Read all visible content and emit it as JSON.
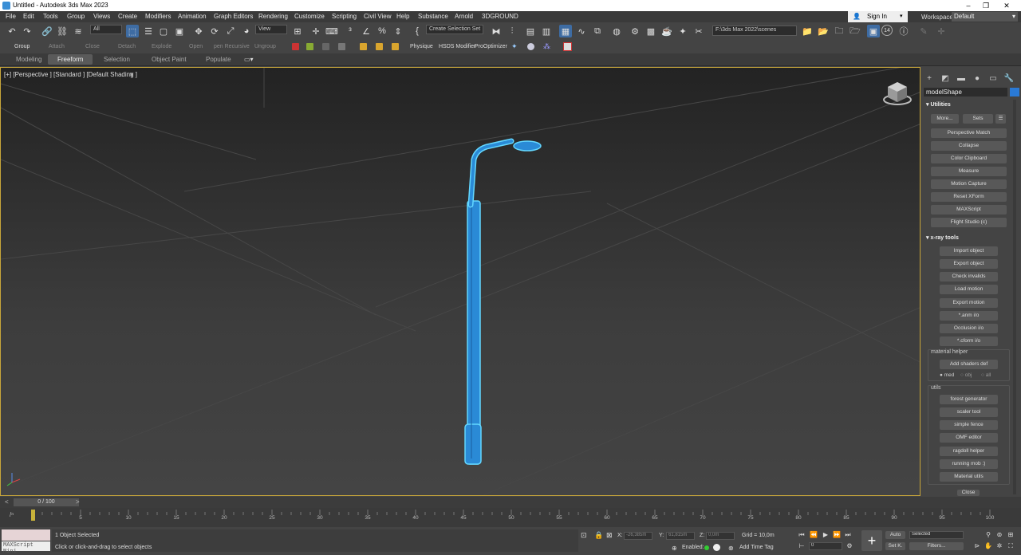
{
  "window": {
    "title": "Untitled - Autodesk 3ds Max 2023"
  },
  "menu": {
    "items": [
      "File",
      "Edit",
      "Tools",
      "Group",
      "Views",
      "Create",
      "Modifiers",
      "Animation",
      "Graph Editors",
      "Rendering",
      "Customize",
      "Scripting",
      "Civil View",
      "Help",
      "Substance",
      "Arnold",
      "3DGROUND"
    ],
    "sign_in": "Sign In",
    "workspaces_label": "Workspaces:",
    "workspaces_value": "Default"
  },
  "toolbar": {
    "selection_filter": "All",
    "ref_coord": "View",
    "named_selection": "Create Selection Set",
    "project_path": "F:\\3ds Max 2022\\scenes"
  },
  "toolbar2": {
    "items": [
      "Group",
      "Attach",
      "Close",
      "Detach",
      "Explode",
      "Open",
      "pen Recursive",
      "Ungroup"
    ],
    "plugins": [
      "Physique",
      "HSDS Modifier",
      "ProOptimizer"
    ]
  },
  "ribbon": {
    "tabs": [
      "Modeling",
      "Freeform",
      "Selection",
      "Object Paint",
      "Populate"
    ],
    "active": "Freeform"
  },
  "viewport": {
    "label": "[+] [Perspective ] [Standard ] [Default Shading ]"
  },
  "command_panel": {
    "object_name": "modelShape",
    "object_color": "#2a7ad6",
    "utilities": {
      "title": "Utilities",
      "more": "More...",
      "sets": "Sets",
      "buttons": [
        "Perspective Match",
        "Collapse",
        "Color Clipboard",
        "Measure",
        "Motion Capture",
        "Reset XForm",
        "MAXScript",
        "Flight Studio (c)"
      ]
    },
    "xray": {
      "title": "x-ray tools",
      "buttons": [
        "Import object",
        "Export object",
        "Check invalids",
        "Load motion",
        "Export motion",
        "*.anm i/o",
        "Occlusion i/o",
        "*.cform i/o"
      ],
      "material_helper": {
        "label": "material helper",
        "button": "Add shaders def",
        "radios": [
          "med",
          "obj",
          "all"
        ],
        "selected": "med"
      },
      "utils": {
        "label": "utils",
        "buttons": [
          "forest generator",
          "scaler tool",
          "simple fence",
          "OMF editor",
          "ragdoll helper",
          "running mob :)",
          "Material utils"
        ]
      },
      "close": "Close"
    }
  },
  "timeline": {
    "slider": "0 / 100",
    "ticks": [
      "5",
      "10",
      "15",
      "20",
      "25",
      "30",
      "35",
      "40",
      "45",
      "50",
      "55",
      "60",
      "65",
      "70",
      "75",
      "80",
      "85",
      "90",
      "95",
      "100"
    ]
  },
  "status": {
    "maxscript_mini": "MAXScript Mini",
    "selected": "1 Object Selected",
    "prompt": "Click or click-and-drag to select objects",
    "x_label": "X:",
    "x_value": "-26,385m",
    "y_label": "Y:",
    "y_value": "61,815m",
    "z_label": "Z:",
    "z_value": "0,0m",
    "grid": "Grid = 10,0m",
    "enabled": "Enabled:",
    "add_time_tag": "Add Time Tag",
    "auto": "Auto",
    "set_key": "Set K.",
    "key_filter": "Selected",
    "filters": "Filters...",
    "frame": "0",
    "anim_frame": "14"
  },
  "colors": {
    "accent": "#3e6ca3",
    "selection": "#2a8ad6",
    "viewport_border": "#c8a63a"
  }
}
